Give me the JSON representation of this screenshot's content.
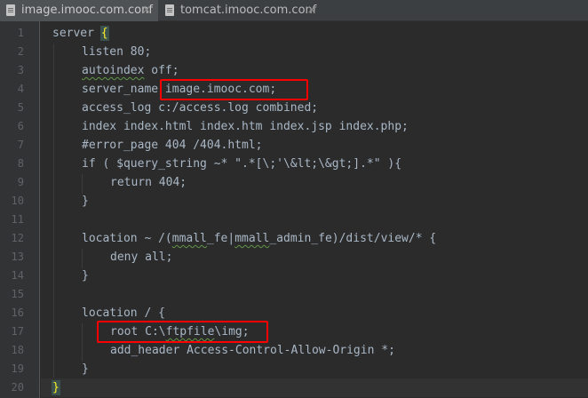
{
  "tabs": [
    {
      "label": "image.imooc.com.conf",
      "close": "×"
    },
    {
      "label": "tomcat.imooc.com.conf",
      "close": "×"
    }
  ],
  "line_numbers": [
    "1",
    "2",
    "3",
    "4",
    "5",
    "6",
    "7",
    "8",
    "9",
    "10",
    "11",
    "12",
    "13",
    "14",
    "15",
    "16",
    "17",
    "18",
    "19",
    "20"
  ],
  "code": {
    "l1": {
      "text": "server ",
      "brace": "{"
    },
    "l2": "listen 80;",
    "l3": {
      "word": "autoindex",
      "rest": " off;"
    },
    "l4": {
      "key": "server_name ",
      "value": "image.imooc.com;"
    },
    "l5": "access_log c:/access.log combined;",
    "l6": "index index.html index.htm index.jsp index.php;",
    "l7": "#error_page 404 /404.html;",
    "l8": "if ( $query_string ~* \".*[\\;'\\&lt;\\&gt;].*\" ){",
    "l9": "return 404;",
    "l10": "}",
    "l12": {
      "pre": "location ~ /(",
      "a": "mmall",
      "mid1": "_fe|",
      "b": "mmall",
      "mid2": "_admin_fe)/dist/view/* {"
    },
    "l13": "deny all;",
    "l14": "}",
    "l16": "location / {",
    "l17": {
      "pre": "root C:\\",
      "word": "ftpfile",
      "post": "\\img;"
    },
    "l18": "add_header Access-Control-Allow-Origin *;",
    "l19": "}",
    "l20": "}"
  },
  "colors": {
    "background": "#2b2b2b",
    "text": "#a9b7c6",
    "annotation_box": "#ff0000"
  }
}
